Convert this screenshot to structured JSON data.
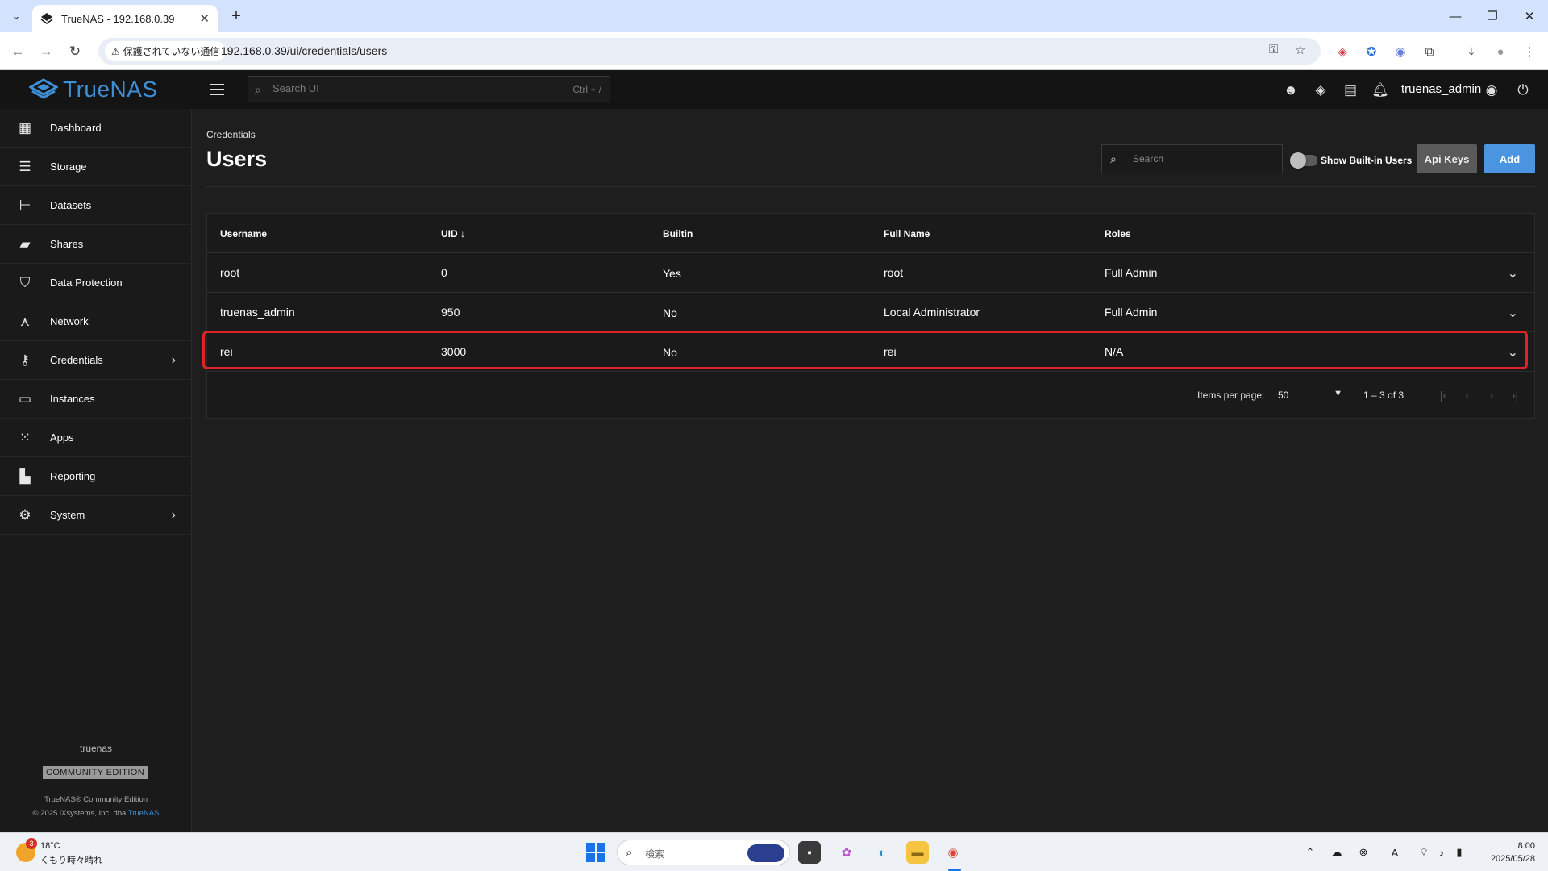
{
  "browser": {
    "tab_title": "TrueNAS - 192.168.0.39",
    "security_label": "保護されていない通信",
    "url": "192.168.0.39/ui/credentials/users"
  },
  "app": {
    "brand": "TrueNAS",
    "search_placeholder": "Search UI",
    "search_shortcut": "Ctrl + /",
    "username": "truenas_admin"
  },
  "sidebar": {
    "items": [
      {
        "label": "Dashboard",
        "icon": "dashboard-icon"
      },
      {
        "label": "Storage",
        "icon": "storage-icon"
      },
      {
        "label": "Datasets",
        "icon": "datasets-icon"
      },
      {
        "label": "Shares",
        "icon": "shares-icon"
      },
      {
        "label": "Data Protection",
        "icon": "shield-icon"
      },
      {
        "label": "Network",
        "icon": "network-icon"
      },
      {
        "label": "Credentials",
        "icon": "key-icon",
        "has_children": true
      },
      {
        "label": "Instances",
        "icon": "laptop-icon"
      },
      {
        "label": "Apps",
        "icon": "apps-grid-icon"
      },
      {
        "label": "Reporting",
        "icon": "chart-icon"
      },
      {
        "label": "System",
        "icon": "gear-icon",
        "has_children": true
      }
    ],
    "hostname": "truenas",
    "edition": "COMMUNITY EDITION",
    "copyright_line1": "TrueNAS® Community Edition",
    "copyright_line2_prefix": "© 2025 iXsystems, Inc. dba",
    "copyright_link": "TrueNAS"
  },
  "page": {
    "breadcrumb": "Credentials",
    "title": "Users",
    "search_placeholder": "Search",
    "toggle_label": "Show Built-in Users",
    "toggle_on": false,
    "api_keys_label": "Api Keys",
    "add_label": "Add"
  },
  "table": {
    "columns": [
      "Username",
      "UID",
      "Builtin",
      "Full Name",
      "Roles"
    ],
    "sort_column": "UID",
    "sort_direction": "descending",
    "rows": [
      {
        "username": "root",
        "uid": "0",
        "builtin": "Yes",
        "full_name": "root",
        "roles": "Full Admin"
      },
      {
        "username": "truenas_admin",
        "uid": "950",
        "builtin": "No",
        "full_name": "Local Administrator",
        "roles": "Full Admin"
      },
      {
        "username": "rei",
        "uid": "3000",
        "builtin": "No",
        "full_name": "rei",
        "roles": "N/A"
      }
    ],
    "highlighted_row": 2
  },
  "paginator": {
    "items_label": "Items per page:",
    "page_size": "50",
    "range": "1 – 3 of 3"
  },
  "taskbar": {
    "weather_badge": "3",
    "temperature": "18°C",
    "weather": "くもり時々晴れ",
    "search_placeholder": "検索",
    "time": "8:00",
    "date": "2025/05/28"
  },
  "colors": {
    "accent": "#4b94e0",
    "brand": "#3d8fd6",
    "highlight": "#e02424",
    "background": "#1e1e1e"
  }
}
